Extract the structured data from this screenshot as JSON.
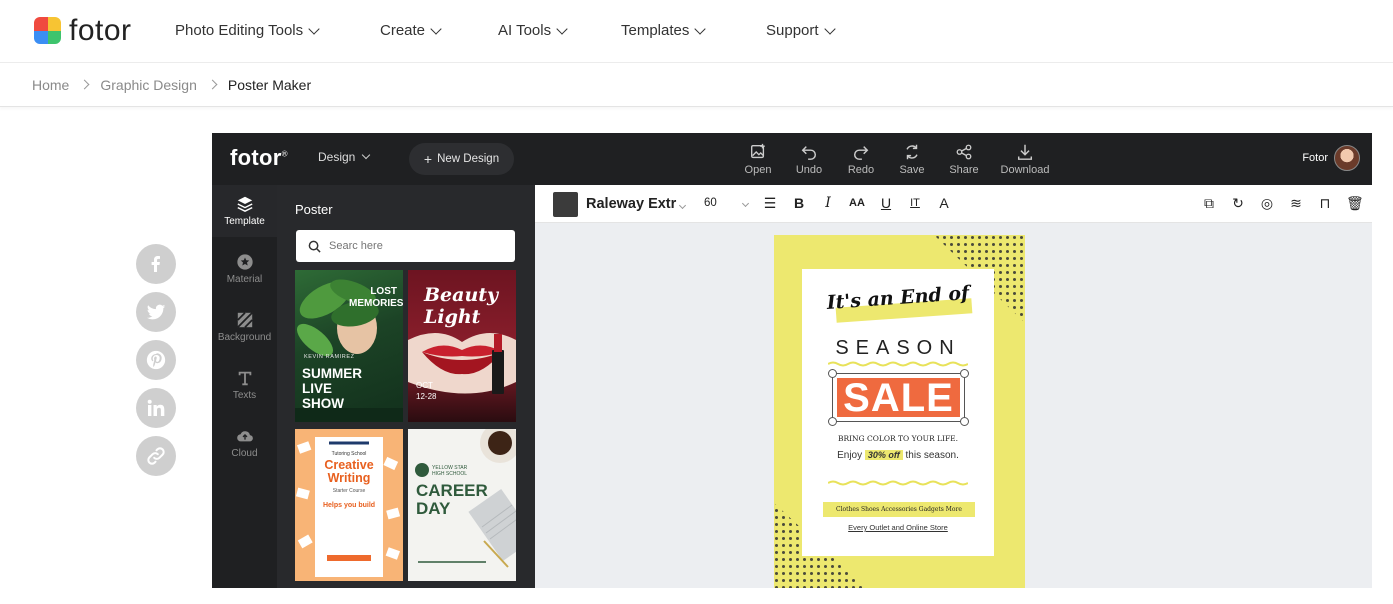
{
  "brand": {
    "name": "fotor"
  },
  "nav": [
    {
      "label": "Photo Editing Tools"
    },
    {
      "label": "Create"
    },
    {
      "label": "AI Tools"
    },
    {
      "label": "Templates"
    },
    {
      "label": "Support"
    }
  ],
  "breadcrumb": [
    {
      "label": "Home"
    },
    {
      "label": "Graphic Design"
    },
    {
      "label": "Poster Maker"
    }
  ],
  "editor": {
    "logo": "fotor",
    "design_menu": "Design",
    "new_design": "New Design",
    "tools": [
      {
        "label": "Open",
        "icon": "open-image-icon"
      },
      {
        "label": "Undo",
        "icon": "undo-icon"
      },
      {
        "label": "Redo",
        "icon": "redo-icon"
      },
      {
        "label": "Save",
        "icon": "save-icon"
      },
      {
        "label": "Share",
        "icon": "share-icon"
      },
      {
        "label": "Download",
        "icon": "download-icon"
      }
    ],
    "user_name": "Fotor",
    "rail": [
      {
        "label": "Template",
        "icon": "layers-icon"
      },
      {
        "label": "Material",
        "icon": "star-icon"
      },
      {
        "label": "Background",
        "icon": "hatch-icon"
      },
      {
        "label": "Texts",
        "icon": "text-icon"
      },
      {
        "label": "Cloud",
        "icon": "cloud-icon"
      }
    ],
    "panel": {
      "title": "Poster",
      "search_placeholder": "Searc here",
      "templates": [
        {
          "top": "LOST MEMORIES",
          "name": "KEVIN RAMIREZ",
          "title": "SUMMER LIVE SHOW",
          "colors": [
            "#1d4a2a",
            "#3f7a3a"
          ]
        },
        {
          "title": "Beauty Light",
          "date": "OCT 12-28",
          "colors": [
            "#4a0f18",
            "#a31d2c"
          ]
        },
        {
          "sub": "Tutoring School",
          "title": "Creative Writing",
          "sub2": "Starter Course",
          "tagline": "Helps you build",
          "colors": [
            "#f7b06a",
            "#e86a2a"
          ]
        },
        {
          "org": "YELLOW STAR HIGH SCHOOL",
          "title": "CAREER DAY",
          "colors": [
            "#f4f4f1",
            "#2f5a3c"
          ]
        }
      ]
    },
    "toolbar": {
      "font_name": "Raleway Extr",
      "font_size": "60",
      "text_color": "#3b3b3b"
    },
    "poster": {
      "headline": "It's an End of",
      "season": "SEASON",
      "sale": "SALE",
      "line1": "BRING COLOR TO YOUR LIFE.",
      "enjoy": "Enjoy",
      "offer": "30% off",
      "suffix": "this season.",
      "banner": "Clothes Shoes Accessories Gadgets More",
      "footer": "Every Outlet and Online Store",
      "colors": {
        "background": "#ede86f",
        "sale": "#ef6a3f",
        "dots": "#4a4a3a"
      }
    }
  },
  "social": [
    {
      "icon": "facebook-icon"
    },
    {
      "icon": "twitter-icon"
    },
    {
      "icon": "pinterest-icon"
    },
    {
      "icon": "linkedin-icon"
    },
    {
      "icon": "link-icon"
    }
  ]
}
